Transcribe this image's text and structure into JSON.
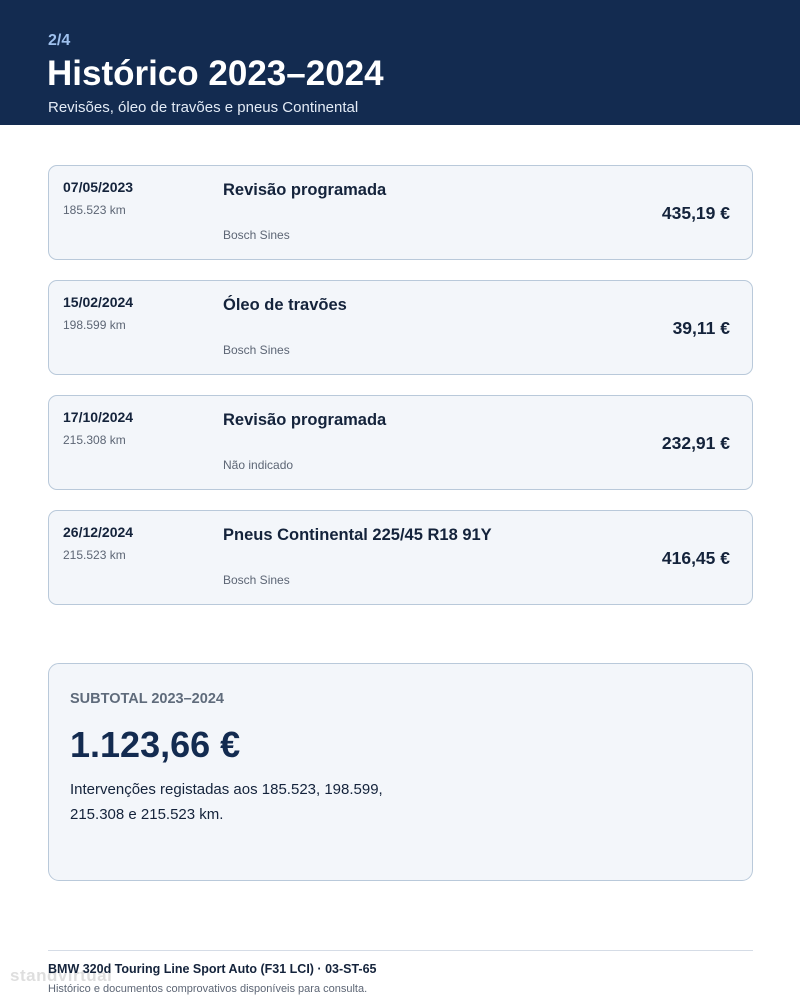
{
  "header": {
    "page_indicator": "2/4",
    "title": "Histórico 2023–2024",
    "subtitle": "Revisões, óleo de travões e pneus Continental"
  },
  "entries": [
    {
      "date": "07/05/2023",
      "km": "185.523 km",
      "title": "Revisão programada",
      "place": "Bosch Sines",
      "amount": "435,19 €"
    },
    {
      "date": "15/02/2024",
      "km": "198.599 km",
      "title": "Óleo de travões",
      "place": "Bosch Sines",
      "amount": "39,11 €"
    },
    {
      "date": "17/10/2024",
      "km": "215.308 km",
      "title": "Revisão programada",
      "place": "Não indicado",
      "amount": "232,91 €"
    },
    {
      "date": "26/12/2024",
      "km": "215.523 km",
      "title": "Pneus Continental 225/45 R18 91Y",
      "place": "Bosch Sines",
      "amount": "416,45 €"
    }
  ],
  "subtotal": {
    "label": "SUBTOTAL 2023–2024",
    "amount": "1.123,66 €",
    "note": "Intervenções registadas aos 185.523, 198.599, 215.308 e 215.523 km."
  },
  "footer": {
    "model": "BMW 320d Touring Line Sport Auto (F31 LCI) · 03-ST-65",
    "note": "Histórico e documentos comprovativos disponíveis para consulta."
  },
  "watermark": "standvirtual",
  "colors": {
    "header_bg": "#132b50",
    "accent": "#9fc1ee",
    "card_bg": "#f3f6fa",
    "card_border": "#b9c9da"
  }
}
